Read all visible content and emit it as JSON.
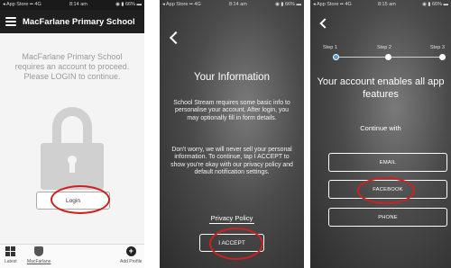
{
  "panel1": {
    "statusbar": {
      "carrier": "◂ App Store ▪▪ 4G",
      "time": "8:14 am",
      "battery": "◉ ▮ 66% ▬"
    },
    "app_title": "MacFarlane Primary School",
    "message": "MacFarlane Primary School requires an account to proceed. Please LOGIN to continue.",
    "login_label": "Login",
    "tabs": {
      "latest": "Latest",
      "school": "MacFarlane",
      "add_profile": "Add Profile"
    },
    "icons": [
      "menu-icon",
      "lock-icon",
      "grid-icon",
      "school-crest-icon",
      "plus-circle-icon"
    ]
  },
  "panel2": {
    "statusbar": {
      "carrier": "◂ App Store ▪▪ 4G",
      "time": "8:14 am",
      "battery": "◉ ▮ 66% ▬"
    },
    "title": "Your Information",
    "text1": "School Stream requires some basic info to personalise your account. After login, you may optionally fill in form details.",
    "text2": "Don't worry, we will never sell your personal information. To continue, tap I ACCEPT to show you're okay with our privacy policy and default notification settings.",
    "privacy_label": "Privacy Policy",
    "accept_label": "I ACCEPT"
  },
  "panel3": {
    "statusbar": {
      "carrier": "◂ App Store ▪▪ 4G",
      "time": "8:15 am",
      "battery": "◉ ▮ 66% ▬"
    },
    "steps": [
      "Step 1",
      "Step 2",
      "Step 3"
    ],
    "active_step": 1,
    "heading": "Your account enables all app features",
    "continue_with": "Continue with",
    "options": {
      "email": "EMAIL",
      "facebook": "FACEBOOK",
      "phone": "PHONE"
    }
  },
  "colors": {
    "highlight_ring": "#d0201e",
    "step_active": "#4aa3df",
    "appbar": "#1f1f1f"
  }
}
